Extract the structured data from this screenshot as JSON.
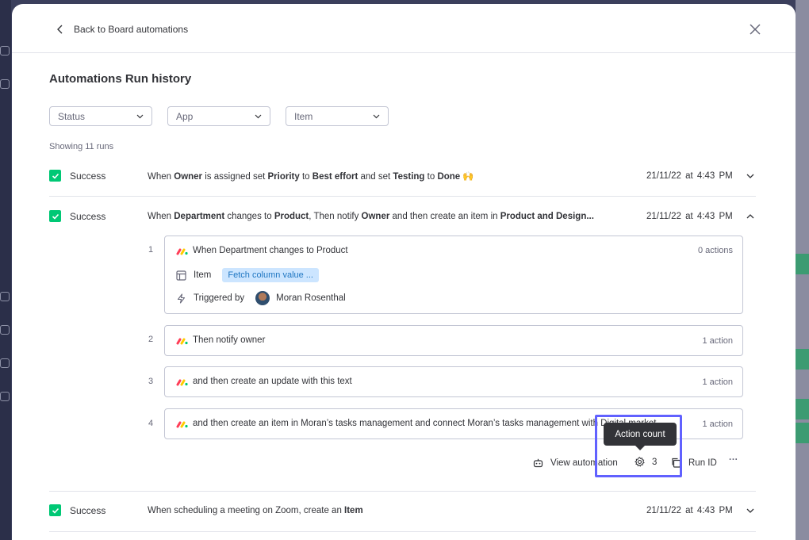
{
  "header": {
    "back_label": "Back to Board automations"
  },
  "page": {
    "title": "Automations Run history",
    "showing": "Showing 11 runs"
  },
  "filters": [
    {
      "label": "Status"
    },
    {
      "label": "App"
    },
    {
      "label": "Item"
    }
  ],
  "runs": [
    {
      "status": "Success",
      "description_parts": [
        [
          "When ",
          false
        ],
        [
          "Owner",
          true
        ],
        [
          " is assigned set ",
          false
        ],
        [
          "Priority",
          true
        ],
        [
          " to ",
          false
        ],
        [
          "Best effort",
          true
        ],
        [
          " and set ",
          false
        ],
        [
          "Testing",
          true
        ],
        [
          " to ",
          false
        ],
        [
          "Done",
          true
        ],
        [
          " 🙌",
          false
        ]
      ],
      "date": "21/11/22 at 4:43 PM",
      "expanded": false
    },
    {
      "status": "Success",
      "description_parts": [
        [
          "When ",
          false
        ],
        [
          "Department",
          true
        ],
        [
          " changes to ",
          false
        ],
        [
          "Product",
          true
        ],
        [
          ", Then notify ",
          false
        ],
        [
          "Owner",
          true
        ],
        [
          " and then create an item in ",
          false
        ],
        [
          "Product and Design...",
          true
        ]
      ],
      "date": "21/11/22 at 4:43 PM",
      "expanded": true
    },
    {
      "status": "Success",
      "description_parts": [
        [
          "When scheduling a meeting on Zoom, create an ",
          false
        ],
        [
          "Item",
          true
        ]
      ],
      "date": "21/11/22 at 4:43 PM",
      "expanded": false
    }
  ],
  "steps": [
    {
      "num": "1",
      "text": "When Department changes to Product",
      "actions": "0 actions",
      "item_label": "Item",
      "item_chip": "Fetch column value ...",
      "triggered_label": "Triggered by",
      "triggered_user": "Moran Rosenthal"
    },
    {
      "num": "2",
      "text": "Then notify owner",
      "actions": "1 action"
    },
    {
      "num": "3",
      "text": "and then create an update with this text",
      "actions": "1 action"
    },
    {
      "num": "4",
      "text": "and then create an item in Moran’s tasks management and connect Moran’s tasks management with Digital market...",
      "actions": "1 action"
    }
  ],
  "footer": {
    "view_automation": "View automation",
    "action_count_value": "3",
    "run_id": "Run ID",
    "more": "···"
  },
  "tooltip": {
    "text": "Action count"
  },
  "colors": {
    "success": "#00c875",
    "highlight": "#6161ff",
    "chip_bg": "#cce5ff"
  },
  "icons": {
    "back": "chevron-left-icon",
    "close": "close-icon",
    "gear": "gear-icon",
    "robot": "robot-icon",
    "copy": "copy-icon",
    "bolt": "lightning-icon",
    "item": "item-board-icon"
  }
}
